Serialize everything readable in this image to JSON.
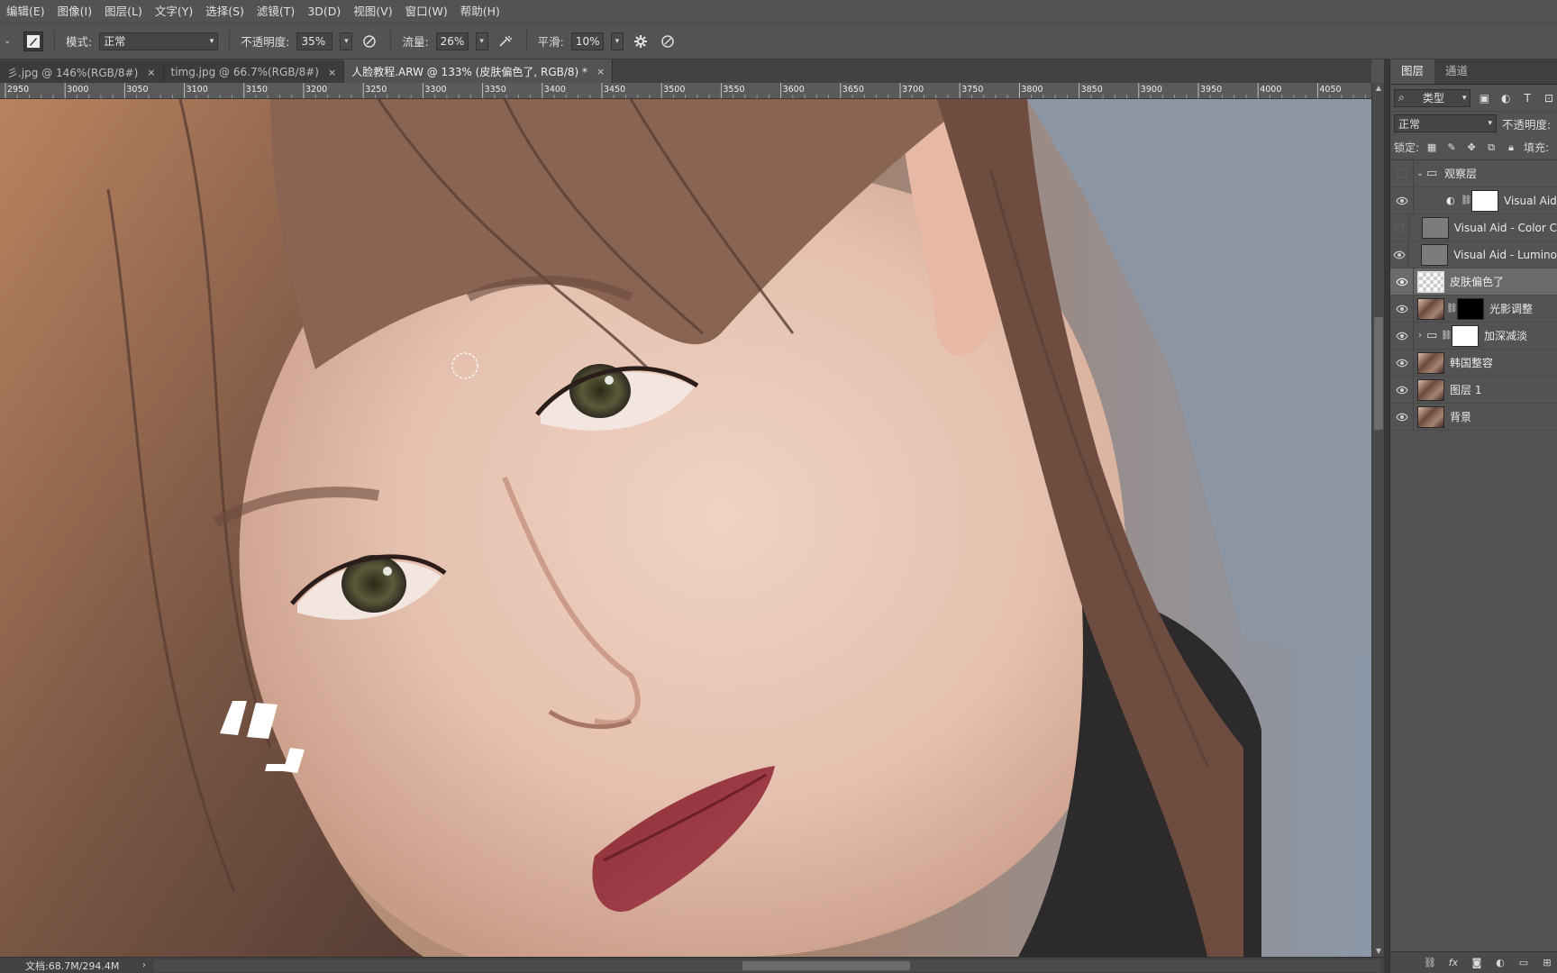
{
  "menu": [
    "编辑(E)",
    "图像(I)",
    "图层(L)",
    "文字(Y)",
    "选择(S)",
    "滤镜(T)",
    "3D(D)",
    "视图(V)",
    "窗口(W)",
    "帮助(H)"
  ],
  "options": {
    "mode_label": "模式:",
    "mode_value": "正常",
    "opacity_label": "不透明度:",
    "opacity_value": "35%",
    "flow_label": "流量:",
    "flow_value": "26%",
    "smooth_label": "平滑:",
    "smooth_value": "10%"
  },
  "tabs": [
    {
      "label": "彡.jpg @ 146%(RGB/8#)",
      "close": "×",
      "active": false
    },
    {
      "label": "timg.jpg @ 66.7%(RGB/8#)",
      "close": "×",
      "active": false
    },
    {
      "label": "人脸教程.ARW @ 133% (皮肤偏色了, RGB/8) *",
      "close": "×",
      "active": true
    }
  ],
  "ruler": {
    "labels": [
      "2950",
      "3000",
      "3050",
      "3100",
      "3150",
      "3200",
      "3250",
      "3300",
      "3350",
      "3400",
      "3450",
      "3500",
      "3550",
      "3600",
      "3650",
      "3700",
      "3750",
      "3800",
      "3850",
      "3900",
      "3950",
      "4000",
      "4050"
    ]
  },
  "status": {
    "doc_info": "文档:68.7M/294.4M",
    "arrow": "›"
  },
  "panel": {
    "tabs": [
      "图层",
      "通道"
    ],
    "filter_label": "类型",
    "blend_mode": "正常",
    "opacity_label": "不透明度:",
    "lock_label": "锁定:",
    "fill_label": "填充:"
  },
  "layers": [
    {
      "name": "观察层",
      "type": "group-open",
      "visible": false
    },
    {
      "name": "Visual Aid",
      "type": "adjustment",
      "visible": true
    },
    {
      "name": "Visual Aid - Color C",
      "type": "gray",
      "visible": false
    },
    {
      "name": "Visual Aid - Lumino",
      "type": "gray",
      "visible": true
    },
    {
      "name": "皮肤偏色了",
      "type": "empty",
      "visible": true,
      "selected": true
    },
    {
      "name": "光影调整",
      "type": "photo-mask",
      "visible": true
    },
    {
      "name": "加深减淡",
      "type": "group",
      "visible": true
    },
    {
      "name": "韩国整容",
      "type": "photo",
      "visible": true
    },
    {
      "name": "图层 1",
      "type": "photo",
      "visible": true
    },
    {
      "name": "背景",
      "type": "photo",
      "visible": true
    }
  ],
  "colors": {
    "ui_bg": "#535353",
    "panel_dark": "#424242",
    "selected_row": "#6a6a6a"
  }
}
